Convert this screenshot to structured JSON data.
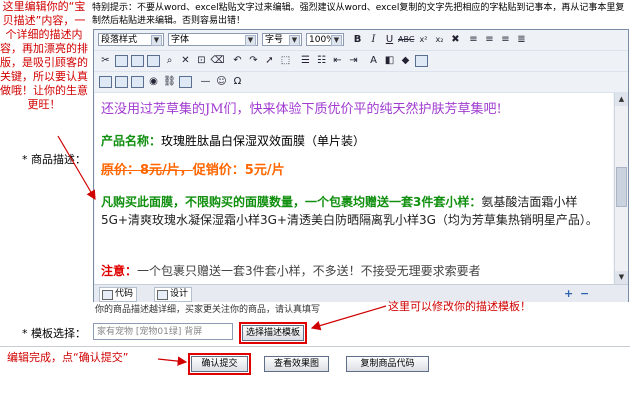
{
  "left_note": "这里编辑你的“宝贝描述”内容，一个详细的描述内容，再加漂亮的排版，是吸引顾客的关键，所以要认真做哦！让你的生意更旺！",
  "hint": {
    "label": "特别提示：",
    "text": "不要从word、excel粘贴文字过来编辑。强烈建议从word、excel复制的文字先把相应的字粘贴到记事本，再从记事本里复制然后粘贴进来编辑。否则容易出错！"
  },
  "field_labels": {
    "description": "* 商品描述：",
    "template": "* 模板选择："
  },
  "toolbar": {
    "paragraph_style": "段落样式",
    "font": "字体",
    "font_size": "字号",
    "zoom": "100%"
  },
  "content": {
    "intro": "还没用过芳草集的JM们，快来体验下质优价平的纯天然护肤芳草集吧!",
    "product_label": "产品名称：",
    "product_name": "玫瑰胜肽晶白保湿双效面膜（单片装）",
    "orig_price": "原价：8元/片，",
    "promo_price": "促销价：5元/片",
    "promo_text": "凡购买此面膜，不限购买的面膜数量，一个包裹均赠送一套3件套小样：",
    "promo_detail": "氨基酸洁面霜小样5G+清爽玫瑰水凝保湿霜小样3G+清透美白防晒隔离乳小样3G（均为芳草集热销明星产品）。",
    "notice_label": "注意：",
    "notice_text": "一个包裹只赠送一套3件套小样，不多送！不接受无理要求索要者"
  },
  "mode": {
    "code": "代码",
    "design": "设计"
  },
  "editor_notice": "你的商品描述越详细，买家更关注你的商品，请认真填写",
  "template_note": "这里可以修改你的描述模板！",
  "template_input": "家有宠物 [宠物01绿] 背屏",
  "buttons": {
    "choose_template": "选择描述模板",
    "submit": "确认提交",
    "preview": "查看效果图",
    "copy_code": "复制商品代码"
  },
  "bottom_note": "编辑完成，点“确认提交”",
  "colors": {
    "annotation_red": "#d00000",
    "intro_purple": "#a03ad0",
    "promo_green": "#119010",
    "price_orange": "#ff6600"
  }
}
